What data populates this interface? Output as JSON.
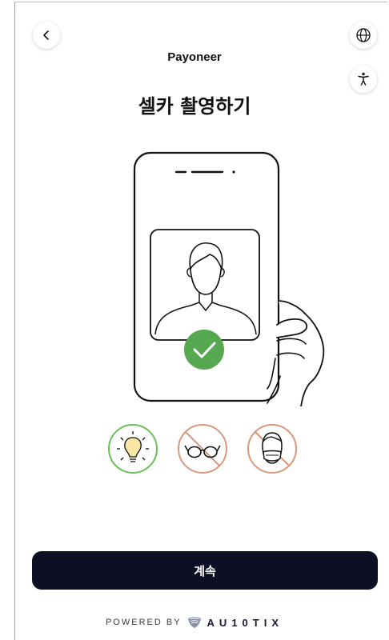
{
  "header": {
    "brand": "Payoneer",
    "back_icon": "chevron-left-icon",
    "language_icon": "globe-icon",
    "accessibility_icon": "accessibility-icon"
  },
  "main": {
    "title": "셀카 촬영하기",
    "illustration_icon": "phone-selfie-illustration",
    "requirements": [
      {
        "icon": "lightbulb-icon",
        "status": "required",
        "color": "#6bbf59"
      },
      {
        "icon": "no-glasses-icon",
        "status": "not-allowed",
        "color": "#d9987a"
      },
      {
        "icon": "no-mask-icon",
        "status": "not-allowed",
        "color": "#d9987a"
      }
    ]
  },
  "footer": {
    "continue_label": "계속",
    "powered_by": "POWERED BY",
    "vendor": "AU10TIX"
  },
  "colors": {
    "accent_check": "#55a84f",
    "button_bg": "#0d0f24",
    "forbidden": "#d9987a",
    "allowed": "#6bbf59"
  }
}
